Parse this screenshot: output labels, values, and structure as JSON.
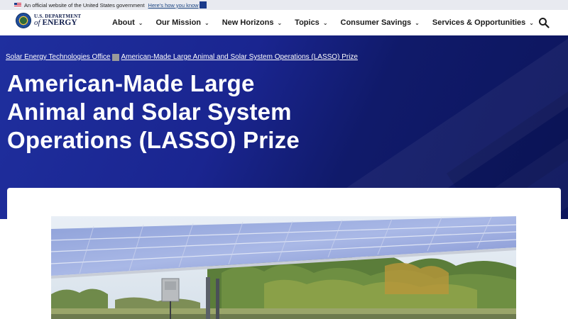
{
  "gov_banner": {
    "text": "An official website of the United States government",
    "link": "Here's how you know"
  },
  "logo": {
    "line1": "U.S. DEPARTMENT",
    "line2_prefix": "of",
    "line2": "ENERGY"
  },
  "nav": {
    "items": [
      {
        "label": "About"
      },
      {
        "label": "Our Mission"
      },
      {
        "label": "New Horizons"
      },
      {
        "label": "Topics"
      },
      {
        "label": "Consumer Savings"
      },
      {
        "label": "Services & Opportunities"
      }
    ],
    "search_icon": "search-icon"
  },
  "breadcrumb": {
    "items": [
      {
        "label": "Solar Energy Technologies Office"
      },
      {
        "label": "American-Made Large Animal and Solar System Operations (LASSO) Prize"
      }
    ]
  },
  "page": {
    "title": "American-Made Large Animal and Solar System Operations (LASSO) Prize"
  },
  "colors": {
    "hero_bg": "#1a2590",
    "header_bg": "#ffffff",
    "banner_bg": "#e8eaf0"
  }
}
